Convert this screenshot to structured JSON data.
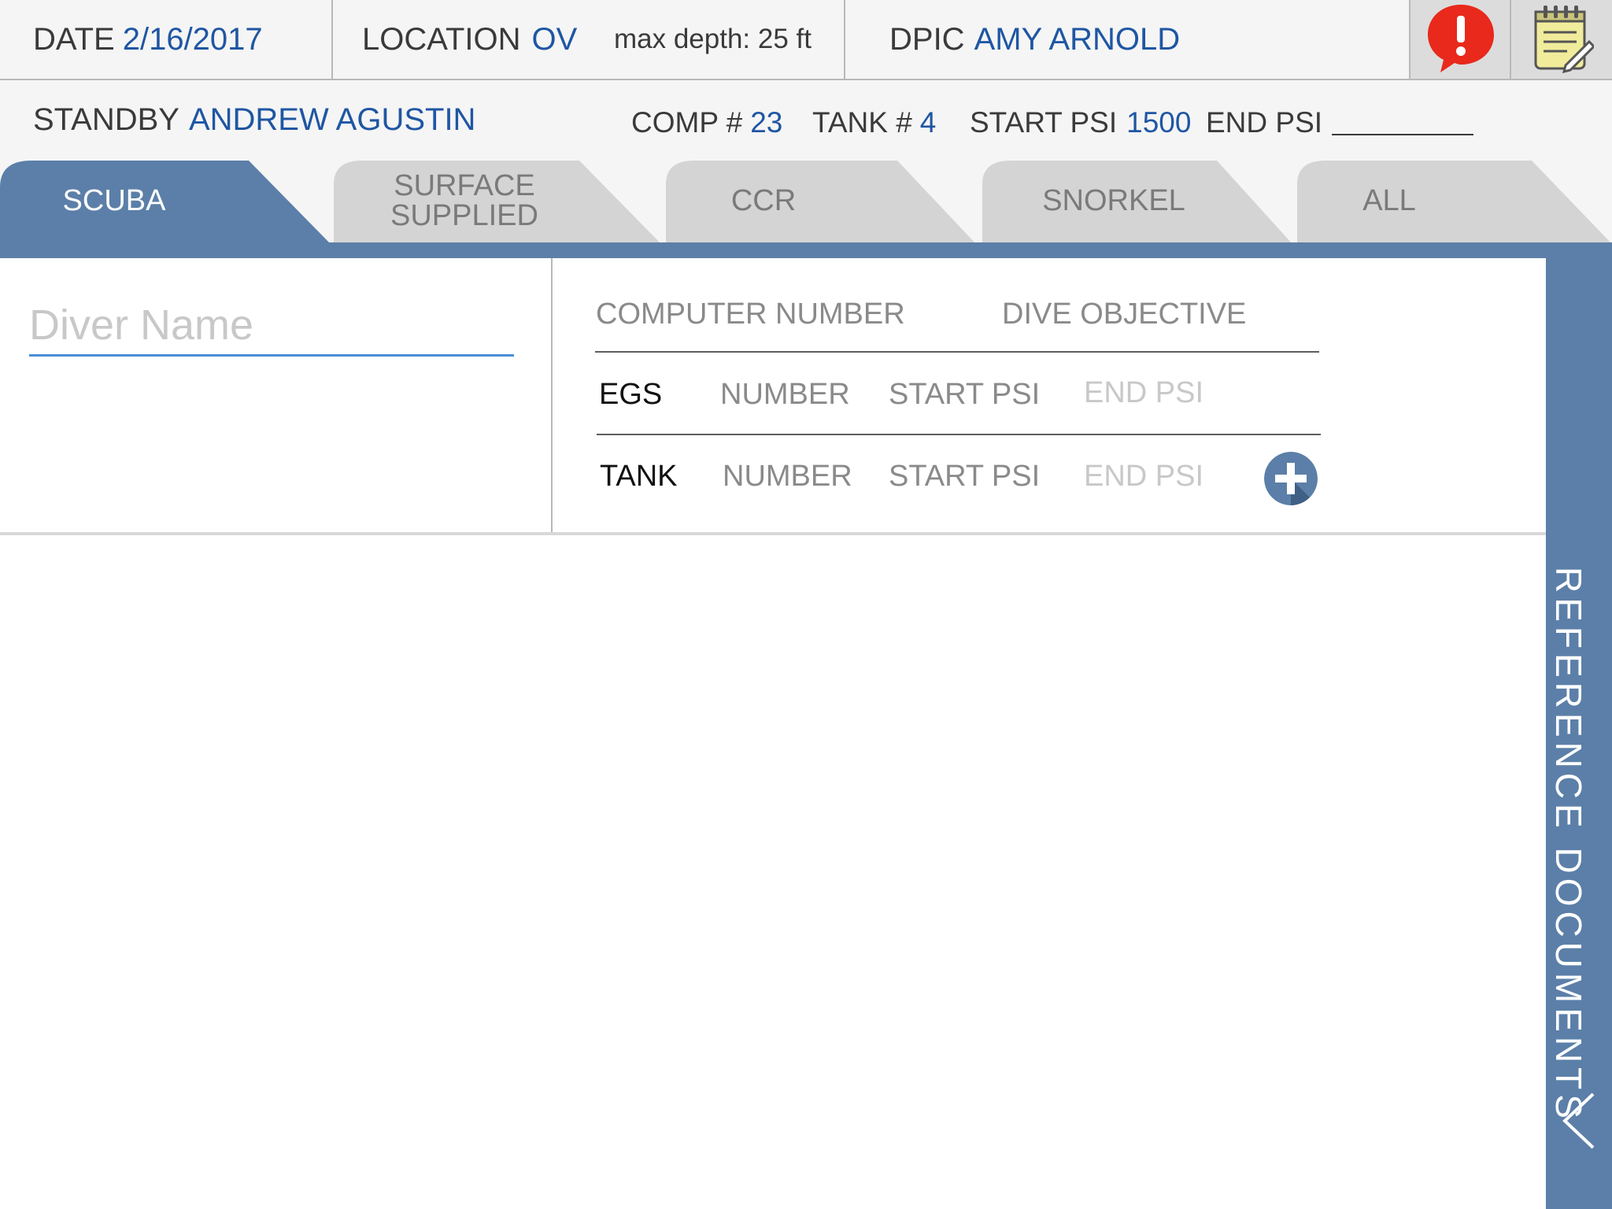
{
  "header": {
    "date_label": "DATE",
    "date_value": "2/16/2017",
    "location_label": "LOCATION",
    "location_value": "OV",
    "max_depth": "max depth: 25 ft",
    "dpic_label": "DPIC",
    "dpic_value": "AMY ARNOLD",
    "alert_icon": "alert-icon",
    "notes_icon": "notepad-icon"
  },
  "subheader": {
    "standby_label": "STANDBY",
    "standby_value": "ANDREW AGUSTIN",
    "comp_label": "COMP #",
    "comp_value": "23",
    "tank_label": "TANK #",
    "tank_value": "4",
    "start_psi_label": "START PSI",
    "start_psi_value": "1500",
    "end_psi_label": "END PSI"
  },
  "tabs": [
    {
      "label": "SCUBA",
      "active": true
    },
    {
      "label": "SURFACE\nSUPPLIED",
      "active": false
    },
    {
      "label": "CCR",
      "active": false
    },
    {
      "label": "SNORKEL",
      "active": false
    },
    {
      "label": "ALL",
      "active": false
    }
  ],
  "form": {
    "diver_name_placeholder": "Diver Name",
    "computer_number": "COMPUTER NUMBER",
    "dive_objective": "DIVE OBJECTIVE",
    "egs": {
      "label": "EGS",
      "number": "NUMBER",
      "start_psi": "START PSI",
      "end_psi": "END PSI"
    },
    "tank": {
      "label": "TANK",
      "number": "NUMBER",
      "start_psi": "START PSI",
      "end_psi": "END PSI"
    },
    "add_icon": "plus-icon"
  },
  "sidebar": {
    "label": "REFERENCE DOCUMENTS",
    "chevron_icon": "chevron-left-icon"
  },
  "colors": {
    "accent": "#1f56a3",
    "tab_active": "#5b7fa8",
    "tab_inactive": "#d4d4d4",
    "alert": "#e8291c",
    "input_underline": "#4a8fd9"
  }
}
